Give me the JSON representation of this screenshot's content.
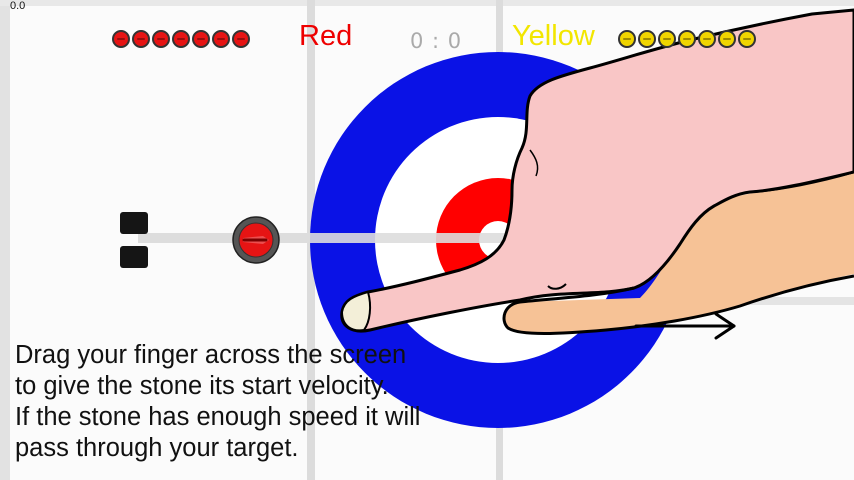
{
  "debug": {
    "fps": "0.0"
  },
  "scoreboard": {
    "red": {
      "label": "Red",
      "color": "#ee0000",
      "stones_remaining": 7
    },
    "score": "0 : 0",
    "yellow": {
      "label": "Yellow",
      "color": "#f2e600",
      "stones_remaining": 7
    }
  },
  "stone_colors": {
    "red": "#e61414",
    "yellow": "#f0d500"
  },
  "house_colors": {
    "outer_ring": "#0a12e6",
    "inner_ring": "#ff0000",
    "ice": "#ffffff"
  },
  "tutorial": {
    "lines": [
      "Drag your finger across the screen",
      "to give the stone its start velocity.",
      "If the stone has enough speed it will",
      "pass through your target."
    ],
    "gesture_icon": "hand-pointer-icon",
    "direction_icon": "arrow-right-icon"
  }
}
